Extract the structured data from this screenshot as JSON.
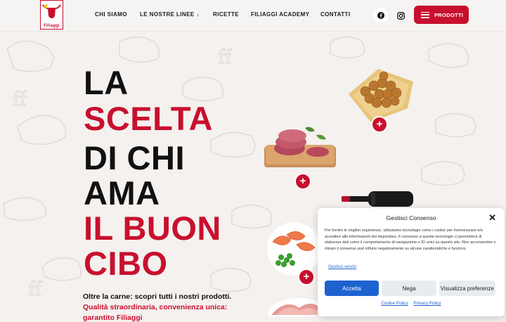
{
  "header": {
    "logo_text": "Filiaggi",
    "nav": [
      {
        "label": "CHI SIAMO"
      },
      {
        "label": "LE NOSTRE LINEE",
        "arrow": "↓"
      },
      {
        "label": "RICETTE"
      },
      {
        "label": "FILIAGGI ACADEMY"
      },
      {
        "label": "CONTATTI"
      }
    ],
    "social_icons": [
      "facebook-icon",
      "instagram-icon"
    ],
    "products_button": "PRODOTTI"
  },
  "hero": {
    "lines": [
      {
        "text": "LA",
        "color": "black"
      },
      {
        "text": "SCELTA",
        "color": "red"
      },
      {
        "text": "DI CHI",
        "color": "black"
      },
      {
        "text": "AMA",
        "color": "black"
      },
      {
        "text": "IL BUON",
        "color": "red"
      },
      {
        "text": "CIBO",
        "color": "red"
      }
    ],
    "subtitle_1": "Oltre la carne: scopri tutti i nostri prodotti.",
    "subtitle_2": "Qualità straordinaria, convenienza unica:",
    "subtitle_3": "garantito Filiaggi"
  },
  "products": [
    {
      "name": "fried-olives",
      "plus": "+"
    },
    {
      "name": "burgers",
      "plus": "+"
    },
    {
      "name": "wine-bottle",
      "plus": "+"
    },
    {
      "name": "shrimp-and-peas",
      "plus": "+"
    }
  ],
  "consent": {
    "title": "Gestisci Consenso",
    "body": "Per fornire le migliori esperienze, utilizziamo tecnologie come i cookie per memorizzare e/o accedere alle informazioni del dispositivo. Il consenso a queste tecnologie ci permetterà di elaborare dati come il comportamento di navigazione o ID unici su questo sito. Non acconsentire o ritirare il consenso può influire negativamente su alcune caratteristiche e funzioni.",
    "manage_services": "Gestisci servizi",
    "accept": "Accetta",
    "deny": "Nega",
    "preferences": "Visualizza preferenze",
    "cookie_policy": "Cookie Policy",
    "privacy_policy": "Privacy Policy"
  },
  "colors": {
    "brand_red": "#c8102e",
    "consent_blue": "#1e62d0",
    "background": "#f4f1ef"
  }
}
